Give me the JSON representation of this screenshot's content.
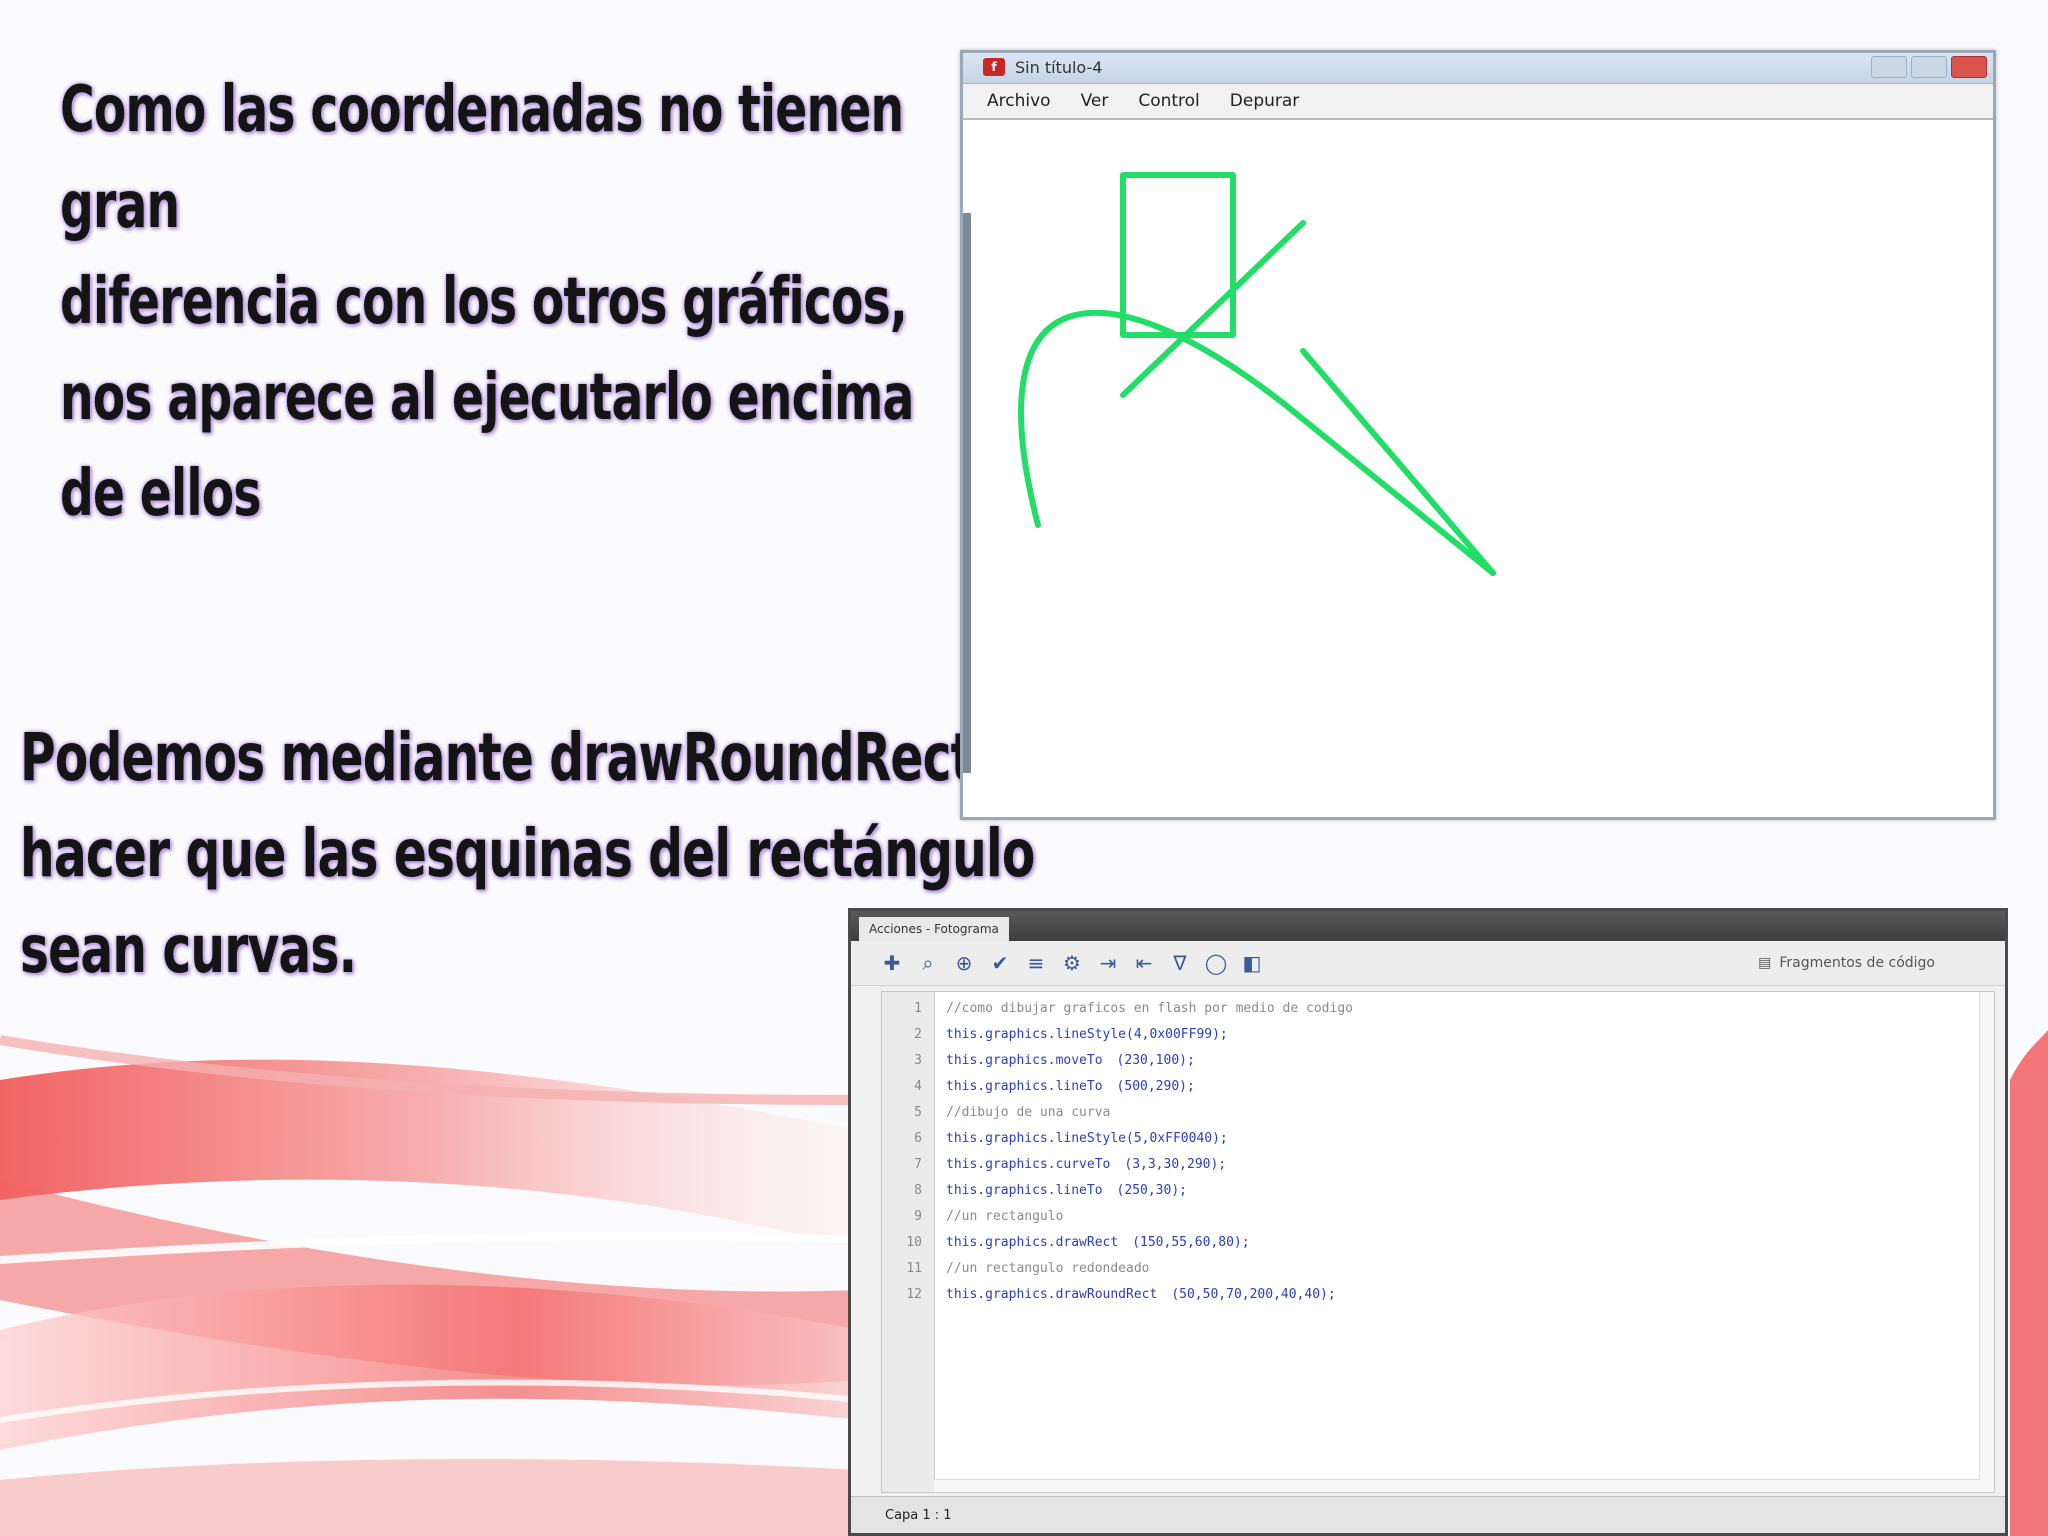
{
  "slide": {
    "paragraph1": [
      "Como las coordenadas no tienen",
      "gran",
      "diferencia con los otros gráficos,",
      "nos aparece al ejecutarlo encima",
      "de ellos"
    ],
    "paragraph2": [
      "Podemos mediante  drawRoundRect",
      "hacer que las esquinas del rectángulo",
      "sean curvas."
    ]
  },
  "player": {
    "title": "Sin título-4",
    "menu": [
      "Archivo",
      "Ver",
      "Control",
      "Depurar"
    ],
    "stroke_color": "#22dd66"
  },
  "actions_panel": {
    "tab_label": "Acciones - Fotograma",
    "snippets_label": "Fragmentos de código",
    "status_label": "Capa 1 : 1",
    "code_lines": [
      {
        "num": "1",
        "text": "//como dibujar graficos en flash por medio de codigo",
        "args": "",
        "comment": true
      },
      {
        "num": "2",
        "text": "this.graphics.lineStyle(4,0x00FF99);",
        "args": "",
        "comment": false
      },
      {
        "num": "3",
        "text": "this.graphics.moveTo",
        "args": "(230,100);",
        "comment": false
      },
      {
        "num": "4",
        "text": "this.graphics.lineTo",
        "args": "(500,290);",
        "comment": false
      },
      {
        "num": "5",
        "text": "//dibujo de una curva",
        "args": "",
        "comment": true
      },
      {
        "num": "6",
        "text": "this.graphics.lineStyle(5,0xFF0040);",
        "args": "",
        "comment": false
      },
      {
        "num": "7",
        "text": "this.graphics.curveTo",
        "args": "(3,3,30,290);",
        "comment": false
      },
      {
        "num": "8",
        "text": "this.graphics.lineTo",
        "args": "(250,30);",
        "comment": false
      },
      {
        "num": "9",
        "text": "//un rectangulo",
        "args": "",
        "comment": true
      },
      {
        "num": "10",
        "text": "this.graphics.drawRect",
        "args": "(150,55,60,80);",
        "comment": false
      },
      {
        "num": "11",
        "text": "//un rectangulo redondeado",
        "args": "",
        "comment": true
      },
      {
        "num": "12",
        "text": "this.graphics.drawRoundRect",
        "args": "(50,50,70,200,40,40);",
        "comment": false
      }
    ]
  }
}
